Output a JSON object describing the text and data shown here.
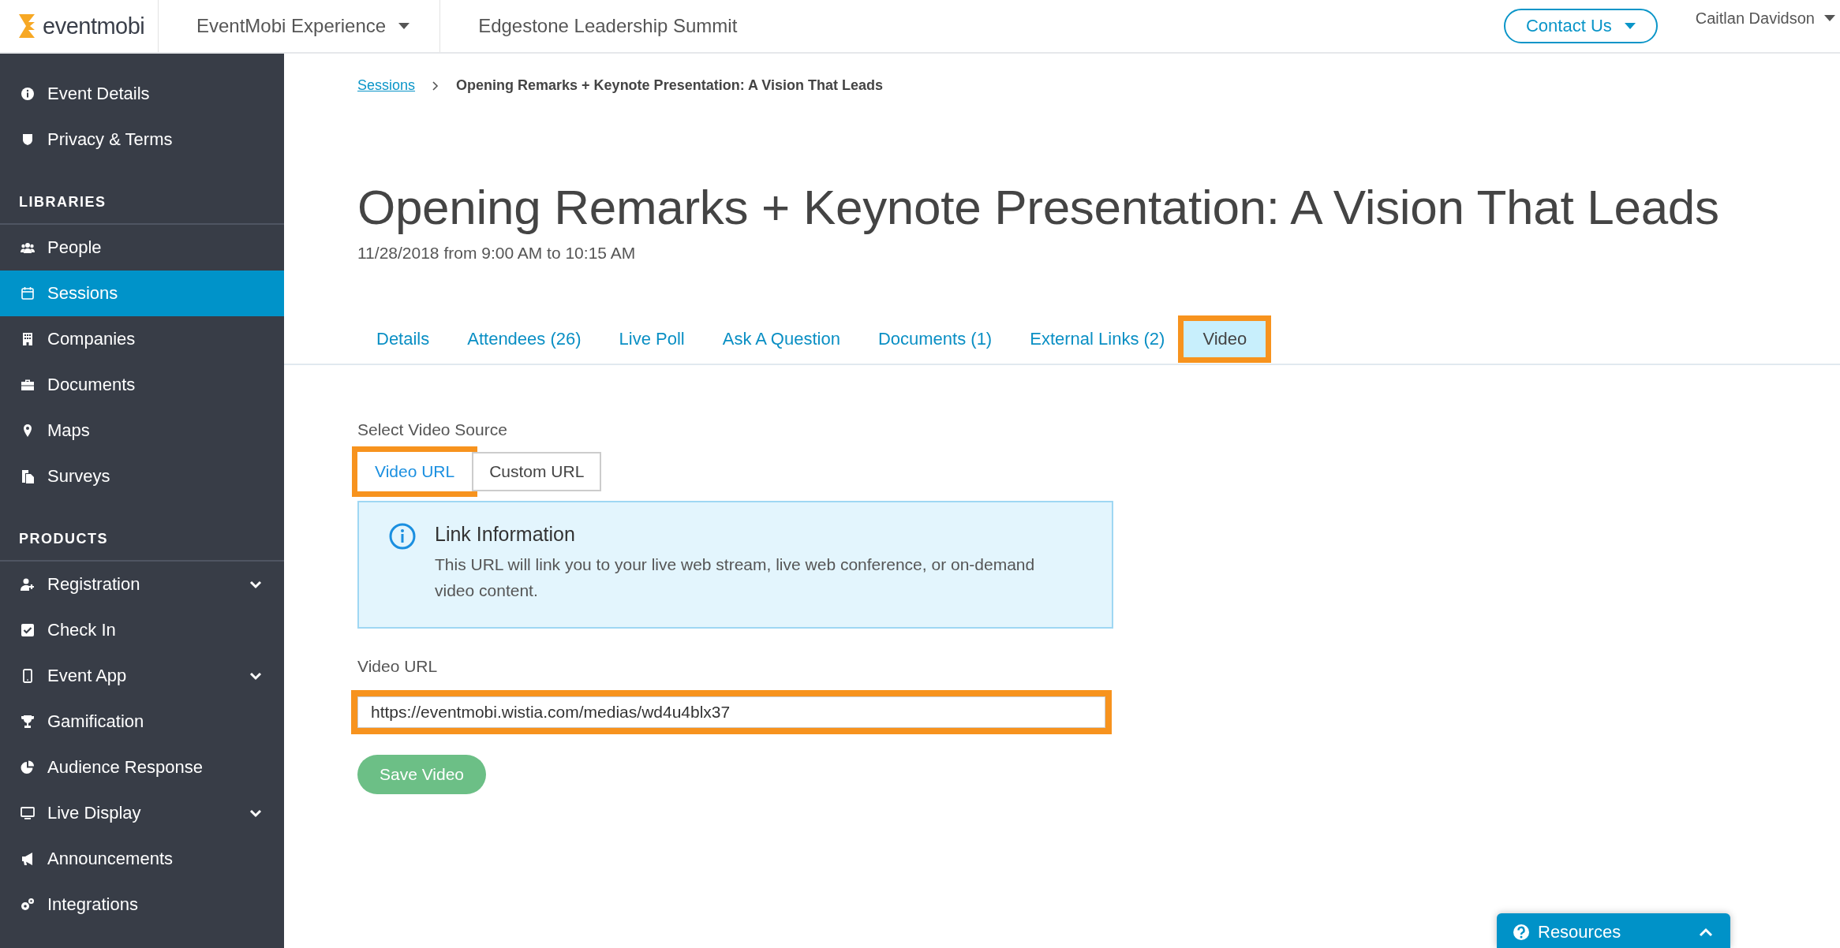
{
  "topbar": {
    "logo": "eventmobi",
    "crumbs": [
      {
        "label": "EventMobi Experience",
        "dropdown": true
      },
      {
        "label": "Edgestone Leadership Summit",
        "dropdown": false
      }
    ],
    "contact": "Contact Us",
    "user": "Caitlan Davidson"
  },
  "sidebar": {
    "sections": [
      {
        "items": [
          {
            "label": "Event Details",
            "selected": false,
            "submenu": false
          },
          {
            "label": "Privacy & Terms",
            "selected": false,
            "submenu": false
          }
        ]
      },
      {
        "heading": "LIBRARIES",
        "items": [
          {
            "label": "People",
            "selected": false,
            "submenu": false
          },
          {
            "label": "Sessions",
            "selected": true,
            "submenu": false
          },
          {
            "label": "Companies",
            "selected": false,
            "submenu": false
          },
          {
            "label": "Documents",
            "selected": false,
            "submenu": false
          },
          {
            "label": "Maps",
            "selected": false,
            "submenu": false
          },
          {
            "label": "Surveys",
            "selected": false,
            "submenu": false
          }
        ]
      },
      {
        "heading": "PRODUCTS",
        "items": [
          {
            "label": "Registration",
            "selected": false,
            "submenu": true
          },
          {
            "label": "Check In",
            "selected": false,
            "submenu": false
          },
          {
            "label": "Event App",
            "selected": false,
            "submenu": true
          },
          {
            "label": "Gamification",
            "selected": false,
            "submenu": false
          },
          {
            "label": "Audience Response",
            "selected": false,
            "submenu": false
          },
          {
            "label": "Live Display",
            "selected": false,
            "submenu": true
          },
          {
            "label": "Announcements",
            "selected": false,
            "submenu": false
          },
          {
            "label": "Integrations",
            "selected": false,
            "submenu": false
          }
        ]
      }
    ]
  },
  "breadcrumb": {
    "link": "Sessions",
    "current": "Opening Remarks + Keynote Presentation: A Vision That Leads"
  },
  "title": "Opening Remarks + Keynote Presentation: A Vision That Leads",
  "date": "11/28/2018 from 9:00 AM to 10:15 AM",
  "tabs": [
    {
      "label": "Details",
      "selected": false,
      "highlighted": false
    },
    {
      "label": "Attendees (26)",
      "selected": false,
      "highlighted": false
    },
    {
      "label": "Live Poll",
      "selected": false,
      "highlighted": false
    },
    {
      "label": "Ask A Question",
      "selected": false,
      "highlighted": false
    },
    {
      "label": "Documents (1)",
      "selected": false,
      "highlighted": false
    },
    {
      "label": "External Links (2)",
      "selected": false,
      "highlighted": false
    },
    {
      "label": "Video",
      "selected": true,
      "highlighted": true
    }
  ],
  "source": {
    "label": "Select Video Source",
    "options": [
      {
        "label": "Video URL",
        "selected": true,
        "highlighted": true
      },
      {
        "label": "Custom URL",
        "selected": false,
        "highlighted": false
      }
    ]
  },
  "info": {
    "title": "Link Information",
    "text": "This URL will link you to your live web stream, live web conference, or on-demand video content."
  },
  "url_field": {
    "label": "Video URL",
    "value": "https://eventmobi.wistia.com/medias/wd4u4blx37",
    "highlighted": true
  },
  "save": "Save Video",
  "resources": "Resources"
}
